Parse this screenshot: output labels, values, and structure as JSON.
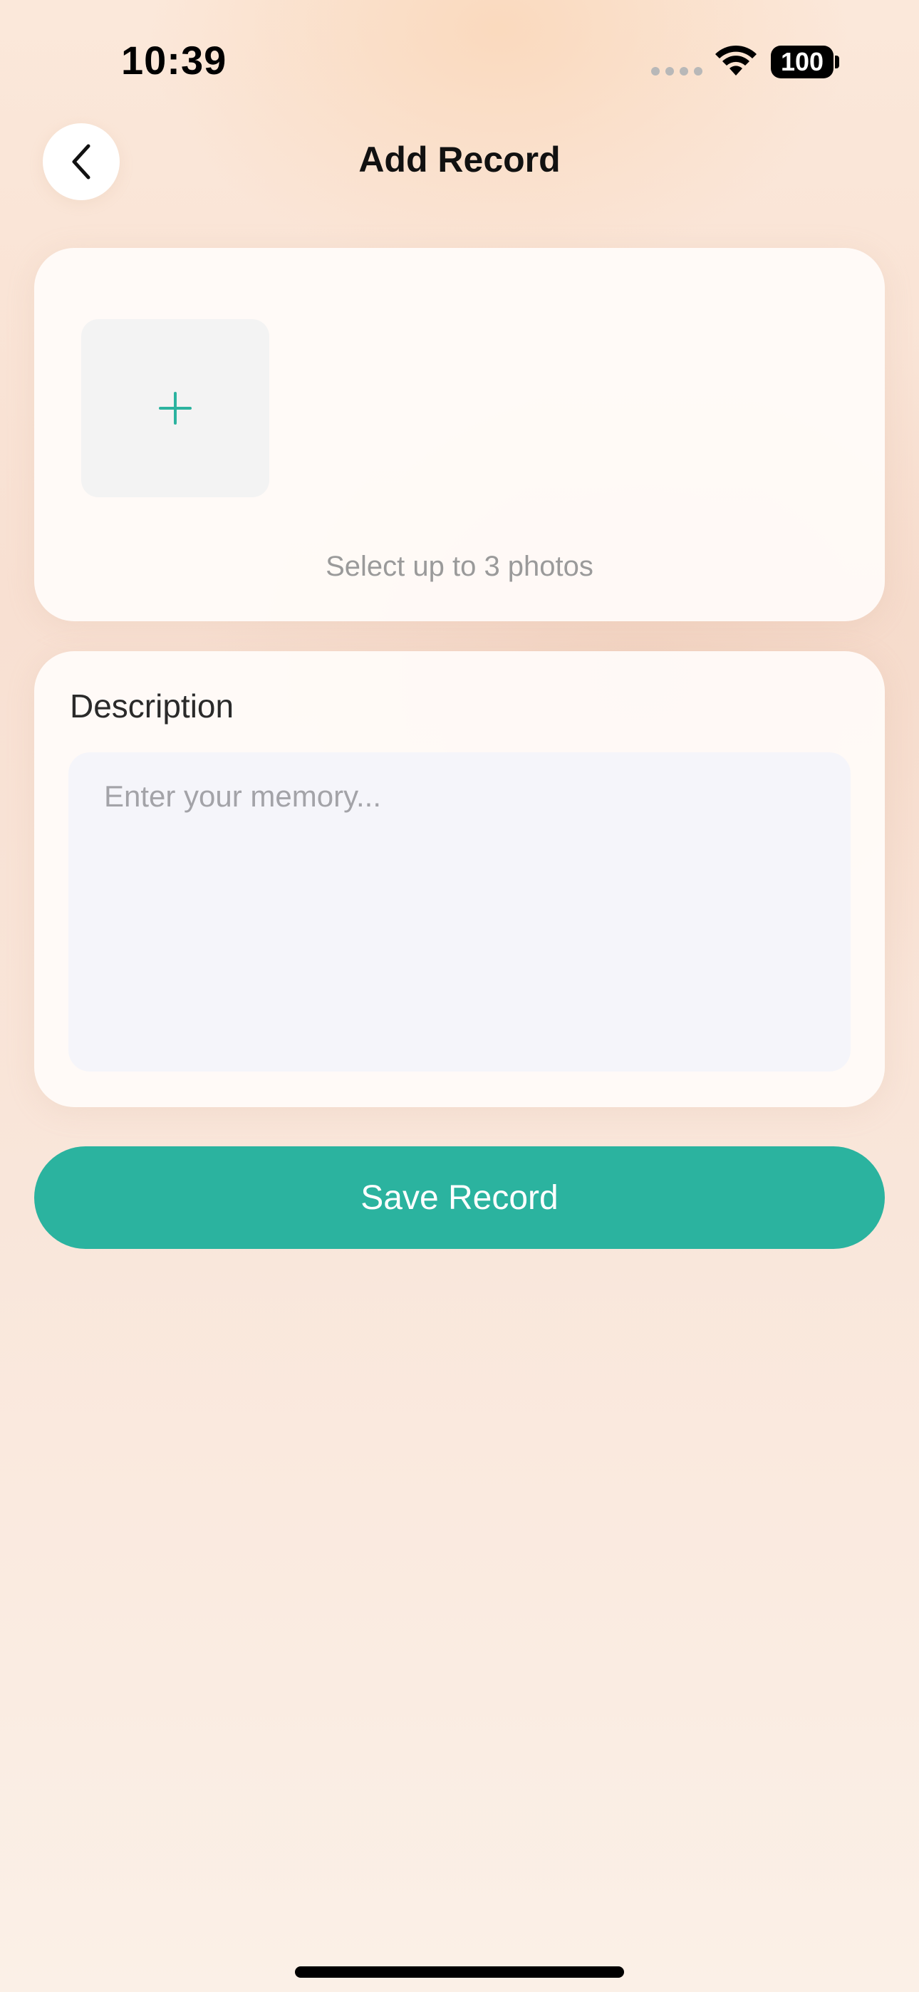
{
  "status_bar": {
    "time": "10:39",
    "battery": "100"
  },
  "header": {
    "title": "Add Record",
    "back_icon": "chevron-left-icon"
  },
  "photos": {
    "add_icon": "plus-icon",
    "hint": "Select up to 3 photos"
  },
  "description": {
    "label": "Description",
    "value": "",
    "placeholder": "Enter your memory..."
  },
  "actions": {
    "save_label": "Save Record"
  },
  "colors": {
    "accent": "#2bb39f",
    "card": "#fffcfa",
    "input_bg": "#f5f5fa"
  }
}
